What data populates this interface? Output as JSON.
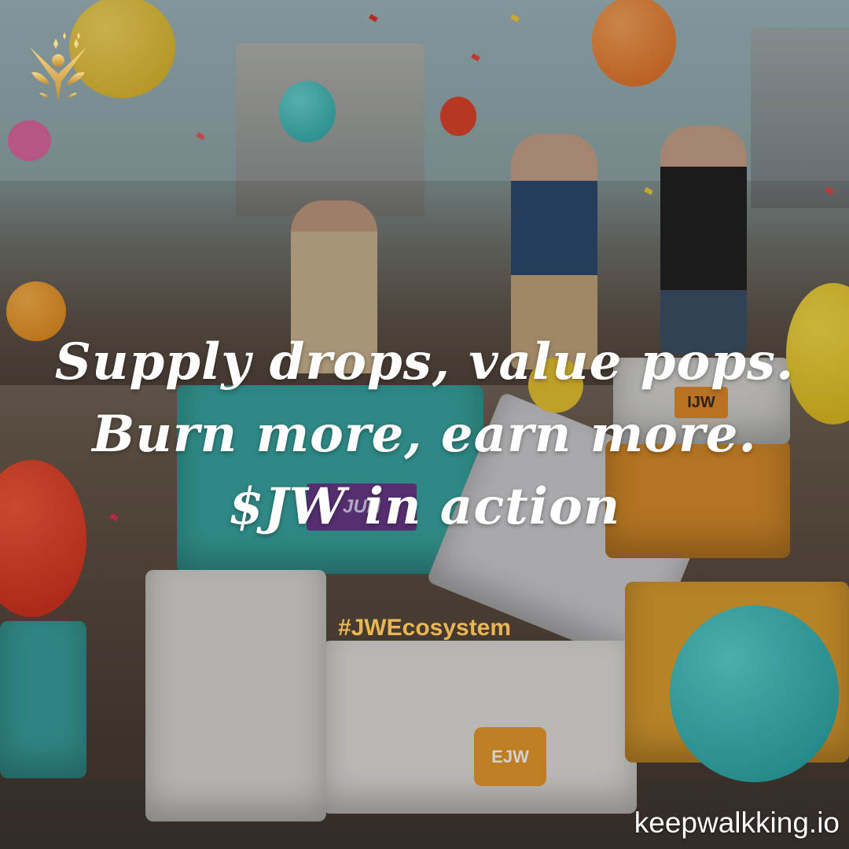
{
  "post": {
    "headline": "Supply drops, value pops. Burn more, earn more. $JW in action",
    "hashtag": "#JWEcosystem",
    "website": "keepwalkking.io",
    "logo_icon": "golden-figure-with-wings-logo"
  },
  "colors": {
    "hashtag": "#e8b654",
    "headline": "#ffffff",
    "logo": "#e9b75a"
  },
  "scene_labels": {
    "box_label_1": "EJW",
    "box_label_2": "IJW",
    "box_label_3": "JUN"
  }
}
